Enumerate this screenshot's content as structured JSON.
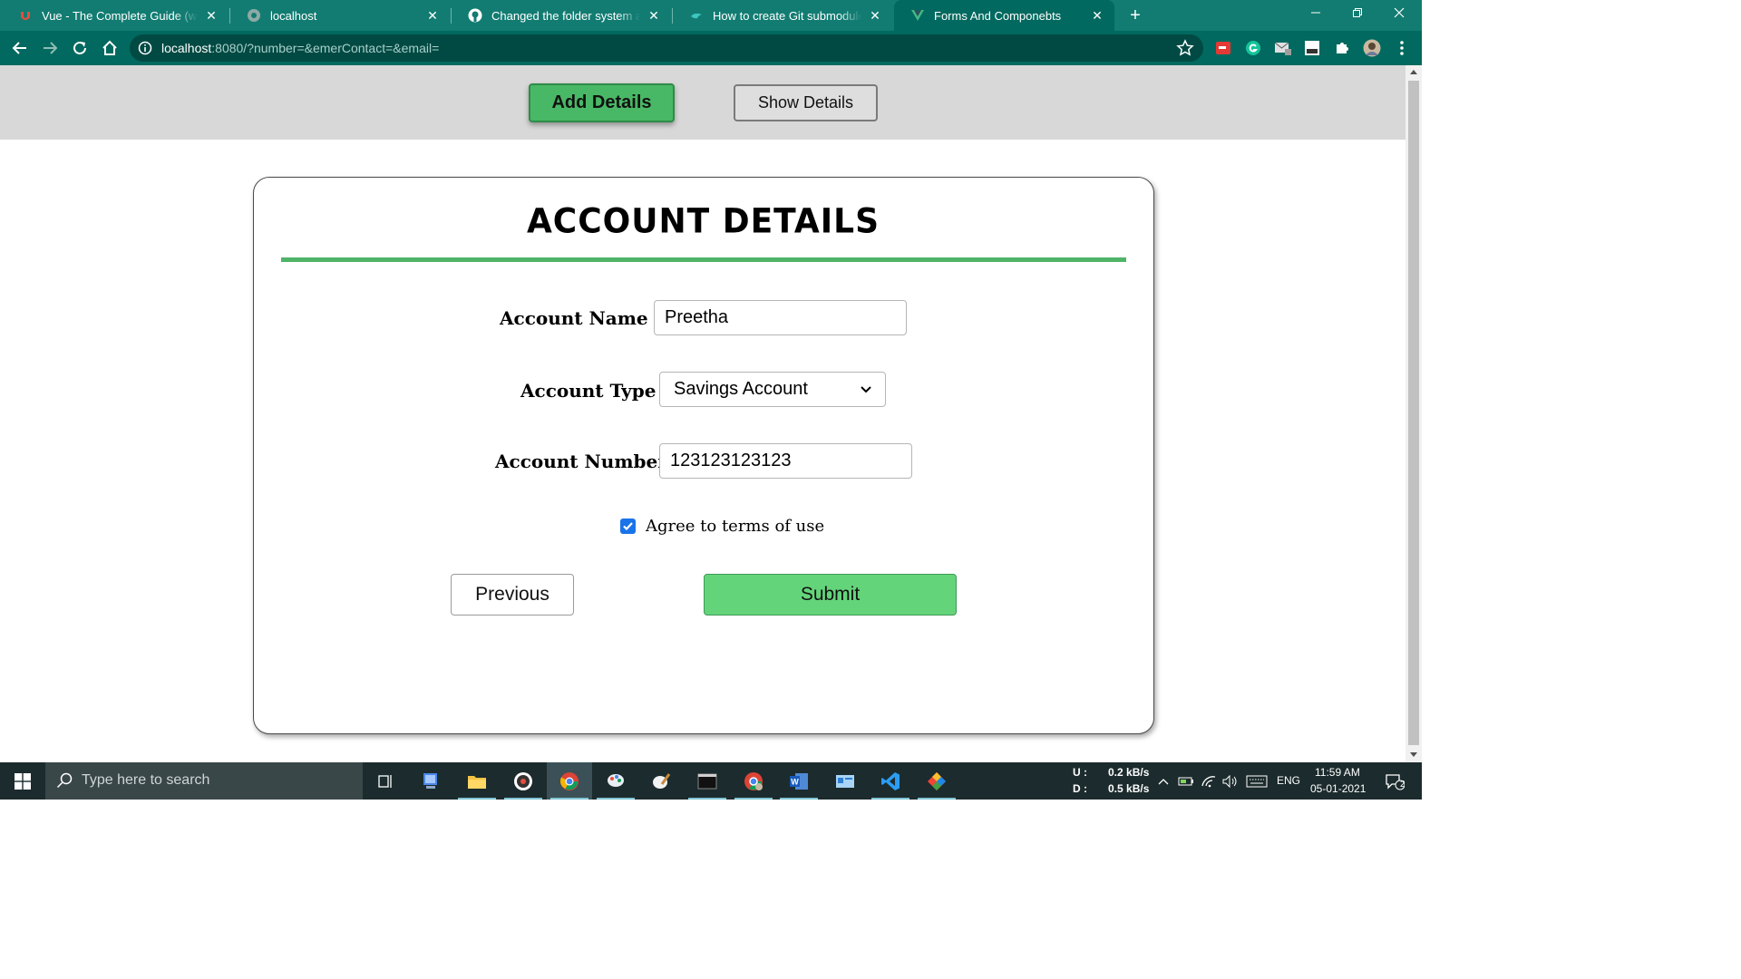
{
  "browser": {
    "tabs": [
      {
        "title": "Vue - The Complete Guide (w/ Router, Vuex, Composition API)",
        "icon": "udemy-icon"
      },
      {
        "title": "localhost",
        "icon": "globe-icon"
      },
      {
        "title": "Changed the folder system and added components",
        "icon": "github-icon"
      },
      {
        "title": "How to create Git submodules in GitHub",
        "icon": "bird-icon"
      },
      {
        "title": "Forms And Componebts",
        "icon": "vue-icon",
        "active": true
      }
    ],
    "new_tab_label": "+",
    "url_host": "localhost",
    "url_rest": ":8080/?number=&emerContact=&email="
  },
  "page": {
    "nav": {
      "add_details": "Add Details",
      "show_details": "Show Details"
    },
    "card": {
      "title": "ACCOUNT DETAILS",
      "account_name_label": "Account Name :",
      "account_name_value": "Preetha",
      "account_type_label": "Account Type :",
      "account_type_value": "Savings Account",
      "account_number_label": "Account Number",
      "account_number_value": "123123123123",
      "agree_label": "Agree to terms of use",
      "agree_checked": true,
      "previous": "Previous",
      "submit": "Submit"
    },
    "colors": {
      "accent_green": "#49b866",
      "rule_green": "#4fb468",
      "submit_green": "#64d47a",
      "browser_teal": "#127c72"
    }
  },
  "taskbar": {
    "search_placeholder": "Type here to search",
    "net_up_label": "U :",
    "net_up_value": "0.2 kB/s",
    "net_down_label": "D :",
    "net_down_value": "0.5 kB/s",
    "language": "ENG",
    "time": "11:59 AM",
    "date": "05-01-2021",
    "notifications": "2"
  }
}
